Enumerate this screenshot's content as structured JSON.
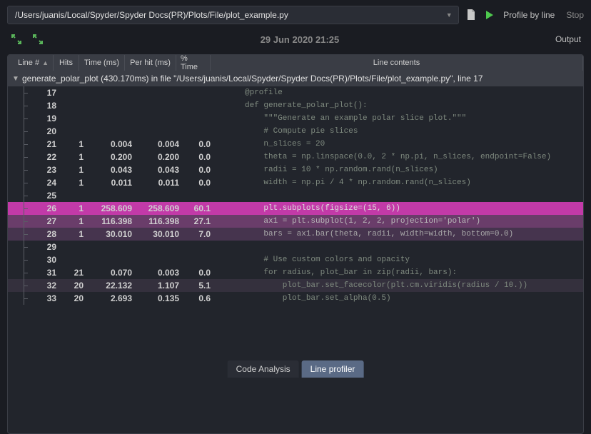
{
  "toolbar": {
    "path": "/Users/juanis/Local/Spyder/Spyder Docs(PR)/Plots/File/plot_example.py",
    "profile_label": "Profile by line",
    "stop_label": "Stop"
  },
  "subbar": {
    "timestamp": "29 Jun 2020 21:25",
    "output_label": "Output"
  },
  "columns": {
    "line": "Line #",
    "hits": "Hits",
    "time": "Time (ms)",
    "perhit": "Per hit (ms)",
    "pct": "% Time",
    "contents": "Line contents"
  },
  "summary": "generate_polar_plot (430.170ms) in file \"/Users/juanis/Local/Spyder/Spyder Docs(PR)/Plots/File/plot_example.py\", line 17",
  "rows": [
    {
      "line": "17",
      "hits": "",
      "time": "",
      "perhit": "",
      "pct": "",
      "code": "@profile"
    },
    {
      "line": "18",
      "hits": "",
      "time": "",
      "perhit": "",
      "pct": "",
      "code": "def generate_polar_plot():"
    },
    {
      "line": "19",
      "hits": "",
      "time": "",
      "perhit": "",
      "pct": "",
      "code": "    \"\"\"Generate an example polar slice plot.\"\"\""
    },
    {
      "line": "20",
      "hits": "",
      "time": "",
      "perhit": "",
      "pct": "",
      "code": "    # Compute pie slices"
    },
    {
      "line": "21",
      "hits": "1",
      "time": "0.004",
      "perhit": "0.004",
      "pct": "0.0",
      "code": "    n_slices = 20"
    },
    {
      "line": "22",
      "hits": "1",
      "time": "0.200",
      "perhit": "0.200",
      "pct": "0.0",
      "code": "    theta = np.linspace(0.0, 2 * np.pi, n_slices, endpoint=False)"
    },
    {
      "line": "23",
      "hits": "1",
      "time": "0.043",
      "perhit": "0.043",
      "pct": "0.0",
      "code": "    radii = 10 * np.random.rand(n_slices)"
    },
    {
      "line": "24",
      "hits": "1",
      "time": "0.011",
      "perhit": "0.011",
      "pct": "0.0",
      "code": "    width = np.pi / 4 * np.random.rand(n_slices)"
    },
    {
      "line": "25",
      "hits": "",
      "time": "",
      "perhit": "",
      "pct": "",
      "code": ""
    },
    {
      "line": "26",
      "hits": "1",
      "time": "258.609",
      "perhit": "258.609",
      "pct": "60.1",
      "code": "    plt.subplots(figsize=(15, 6))",
      "hl": "hl1"
    },
    {
      "line": "27",
      "hits": "1",
      "time": "116.398",
      "perhit": "116.398",
      "pct": "27.1",
      "code": "    ax1 = plt.subplot(1, 2, 2, projection='polar')",
      "hl": "hl2"
    },
    {
      "line": "28",
      "hits": "1",
      "time": "30.010",
      "perhit": "30.010",
      "pct": "7.0",
      "code": "    bars = ax1.bar(theta, radii, width=width, bottom=0.0)",
      "hl": "hl3"
    },
    {
      "line": "29",
      "hits": "",
      "time": "",
      "perhit": "",
      "pct": "",
      "code": ""
    },
    {
      "line": "30",
      "hits": "",
      "time": "",
      "perhit": "",
      "pct": "",
      "code": "    # Use custom colors and opacity"
    },
    {
      "line": "31",
      "hits": "21",
      "time": "0.070",
      "perhit": "0.003",
      "pct": "0.0",
      "code": "    for radius, plot_bar in zip(radii, bars):"
    },
    {
      "line": "32",
      "hits": "20",
      "time": "22.132",
      "perhit": "1.107",
      "pct": "5.1",
      "code": "        plot_bar.set_facecolor(plt.cm.viridis(radius / 10.))",
      "hl": "hl4"
    },
    {
      "line": "33",
      "hits": "20",
      "time": "2.693",
      "perhit": "0.135",
      "pct": "0.6",
      "code": "        plot_bar.set_alpha(0.5)"
    }
  ],
  "tabs": {
    "analysis": "Code Analysis",
    "profiler": "Line profiler"
  }
}
